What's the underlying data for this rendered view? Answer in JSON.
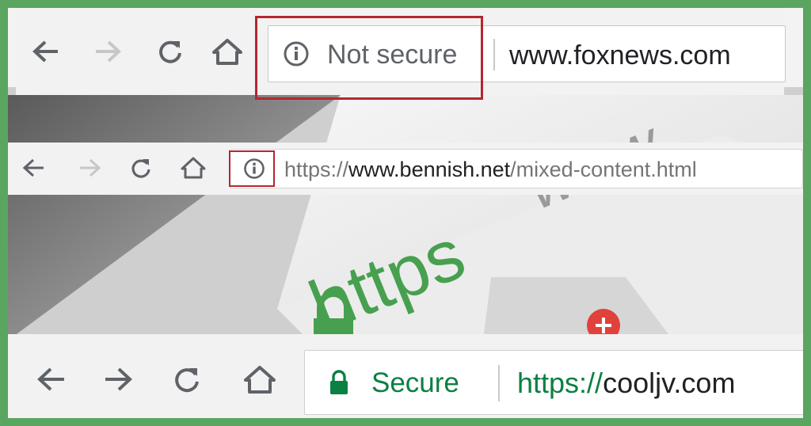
{
  "bar1": {
    "security_label": "Not secure",
    "url": "www.foxnews.com"
  },
  "bar2": {
    "url_scheme": "https://",
    "url_host": "www.bennish.net",
    "url_path": "/mixed-content.html"
  },
  "bar3": {
    "security_label": "Secure",
    "url_scheme": "https://",
    "url_host": "cooljv.com"
  },
  "artwork": {
    "big_text": "https",
    "wave_text": "www."
  },
  "colors": {
    "frame": "#5aa55f",
    "secure_green": "#0b8043",
    "warning_red": "#b5262e",
    "icon_gray": "#5f6368"
  }
}
